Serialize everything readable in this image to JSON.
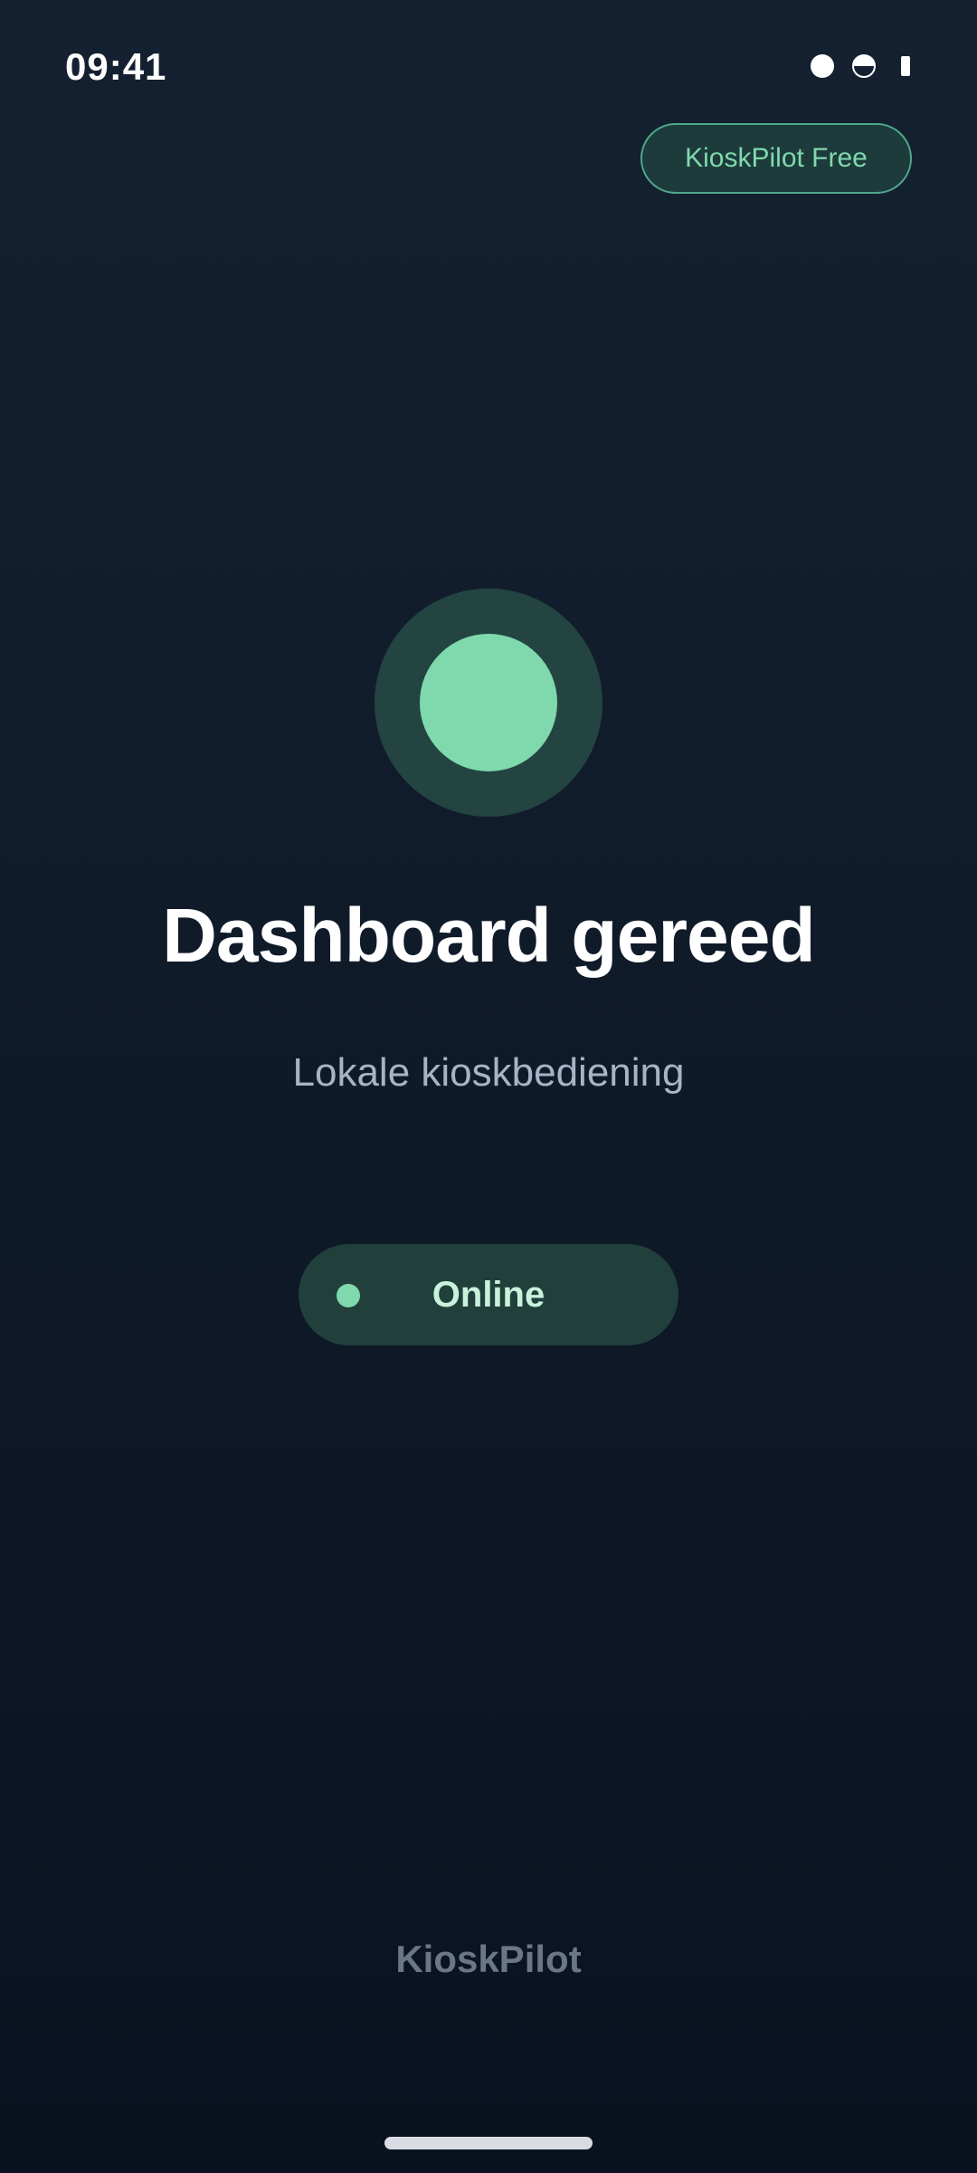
{
  "status_bar": {
    "time": "09:41",
    "icons": [
      "signal-dot-icon",
      "half-circle-icon",
      "battery-icon"
    ]
  },
  "header": {
    "plan_badge": "KioskPilot Free"
  },
  "main": {
    "status_indicator_icon": "status-circle-icon",
    "title": "Dashboard gereed",
    "subtitle": "Lokale kioskbediening",
    "status_pill": {
      "label": "Online",
      "dot_icon": "online-dot-icon"
    }
  },
  "footer": {
    "brand": "KioskPilot"
  },
  "colors": {
    "accent": "#7fd9ad",
    "pill_background": "#213f3b",
    "background_top": "#142131",
    "background_bottom": "#0a1220",
    "subtitle": "#a8b4c6",
    "footer_text": "#6b7787"
  }
}
